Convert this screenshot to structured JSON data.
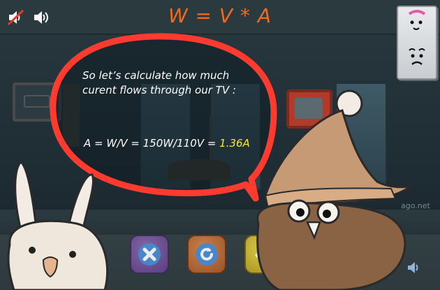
{
  "header": {
    "formula": "W = V * A",
    "mute_music_icon": "music-muted-icon",
    "sound_icon": "speaker-icon"
  },
  "bubble": {
    "line1": "So let’s calculate how much",
    "line2": "curent flows through our TV :",
    "equation": "A = W/V = 150W/110V = ",
    "result": "1.36A"
  },
  "controls": {
    "cancel_icon": "close-icon",
    "replay_icon": "replay-icon",
    "ok_icon": "check-icon"
  },
  "watermark": "ago.net",
  "colors": {
    "formula": "#f36a1f",
    "bubble_border": "#ff3b30",
    "result": "#ffe52b",
    "topbar": "#2b3a3e"
  }
}
